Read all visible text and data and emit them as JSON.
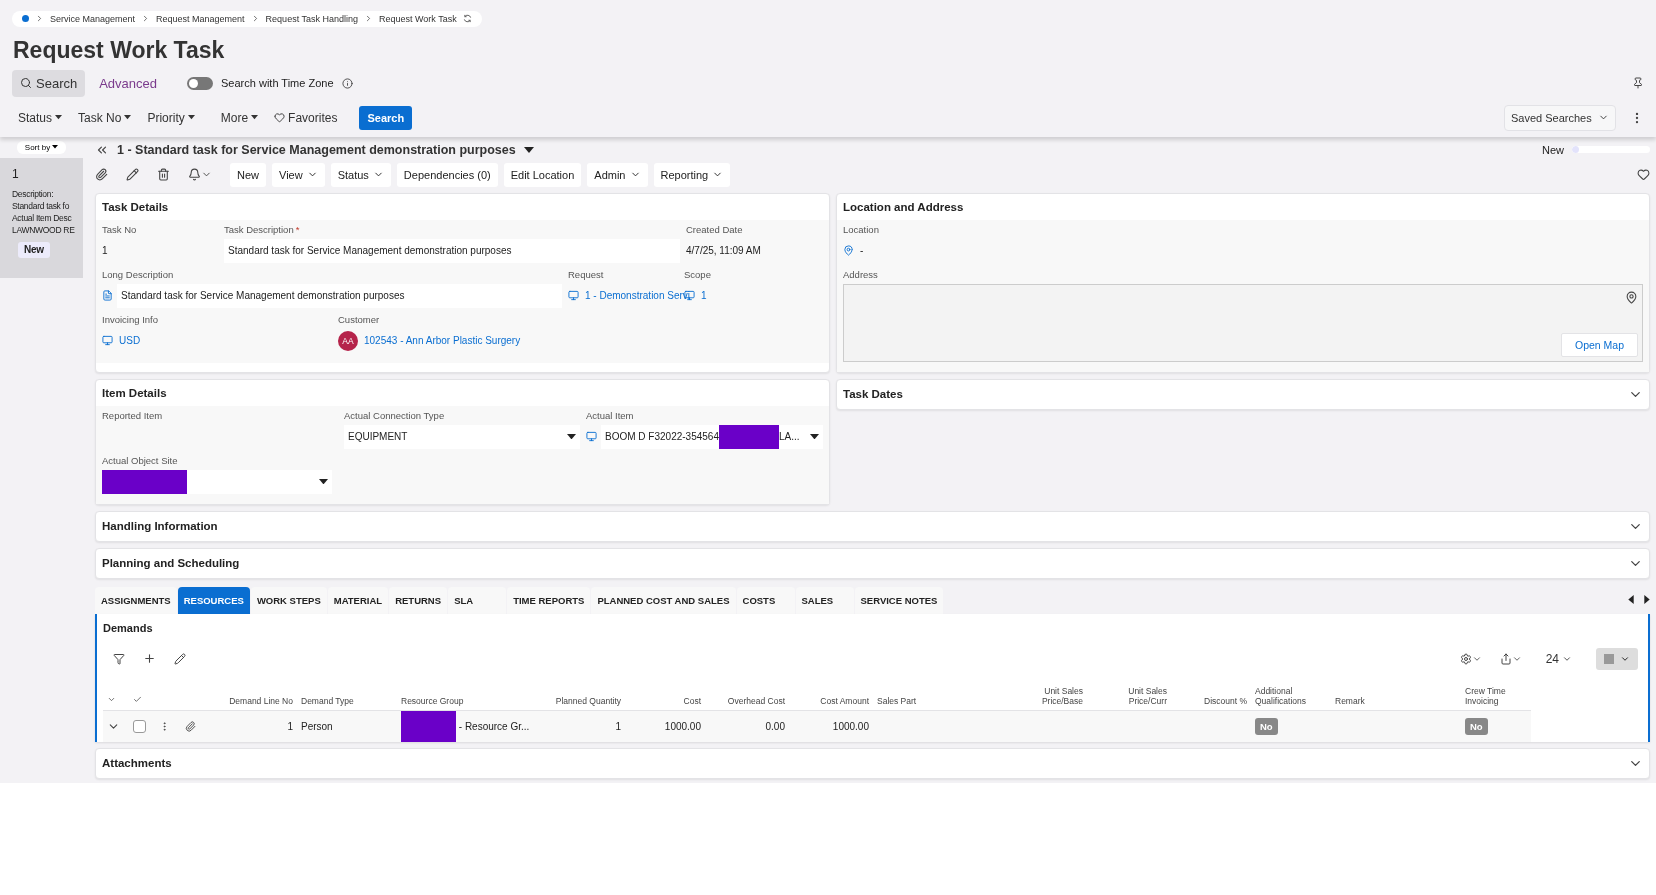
{
  "breadcrumb": [
    "Service Management",
    "Request Management",
    "Request Task Handling",
    "Request Work Task"
  ],
  "title": "Request Work Task",
  "search_bar": {
    "search_tab": "Search",
    "advanced_tab": "Advanced",
    "toggle": {
      "label": "Search with Time Zone",
      "on": false
    },
    "filters": [
      "Status",
      "Task No",
      "Priority",
      "More"
    ],
    "favorites": "Favorites",
    "search_button": "Search",
    "saved_searches": "Saved Searches"
  },
  "list_panel": {
    "sort_by": "Sort by",
    "card": {
      "number": "1",
      "lines": [
        "Description:",
        "Standard task fo",
        "Actual Item Desc",
        "LAWNWOOD RE"
      ],
      "badge": "New"
    }
  },
  "record": {
    "title": "1 - Standard task for Service Management demonstration purposes",
    "status": "New",
    "progress": {
      "level": 0.04
    },
    "toolbar": [
      {
        "label": "New",
        "menu": false
      },
      {
        "label": "View",
        "menu": true
      },
      {
        "label": "Status",
        "menu": true
      },
      {
        "label": "Dependencies (0)",
        "menu": false
      },
      {
        "label": "Edit Location",
        "menu": false
      },
      {
        "label": "Admin",
        "menu": true
      },
      {
        "label": "Reporting",
        "menu": true
      }
    ]
  },
  "task_details": {
    "title": "Task Details",
    "task_no_label": "Task No",
    "task_no": "1",
    "description_label": "Task Description",
    "description_required": "*",
    "description": "Standard task for Service Management demonstration purposes",
    "created_label": "Created Date",
    "created": "4/7/25, 11:09 AM",
    "long_description_label": "Long Description",
    "long_description": "Standard task for Service Management demonstration purposes",
    "request_label": "Request",
    "request": "1 - Demonstration Servi",
    "scope_label": "Scope",
    "scope": "1",
    "invoicing_label": "Invoicing Info",
    "invoicing": "USD",
    "customer_label": "Customer",
    "customer_initials": "AA",
    "customer": "102543 - Ann Arbor Plastic Surgery"
  },
  "location": {
    "title": "Location and Address",
    "location_label": "Location",
    "location": "-",
    "address_label": "Address",
    "open_map": "Open Map"
  },
  "task_dates": {
    "title": "Task Dates",
    "expanded": false
  },
  "item_details": {
    "title": "Item Details",
    "reported_item_label": "Reported Item",
    "connection_type_label": "Actual Connection Type",
    "connection_type": "EQUIPMENT",
    "actual_item_label": "Actual Item",
    "actual_item_start": "BOOM D F32022-354564",
    "actual_item_end": "LA...",
    "object_site_label": "Actual Object Site"
  },
  "sections": [
    {
      "title": "Handling Information",
      "expanded": false
    },
    {
      "title": "Planning and Scheduling",
      "expanded": false
    }
  ],
  "tabs": [
    {
      "label": "ASSIGNMENTS",
      "selected": false
    },
    {
      "label": "RESOURCES",
      "selected": true
    },
    {
      "label": "WORK STEPS",
      "selected": false
    },
    {
      "label": "MATERIAL",
      "selected": false
    },
    {
      "label": "RETURNS",
      "selected": false
    },
    {
      "label": "SLA",
      "selected": false
    },
    {
      "label": "TIME REPORTS",
      "selected": false
    },
    {
      "label": "PLANNED COST AND SALES",
      "selected": false
    },
    {
      "label": "COSTS",
      "selected": false
    },
    {
      "label": "SALES",
      "selected": false
    },
    {
      "label": "SERVICE NOTES",
      "selected": false
    }
  ],
  "demands": {
    "title": "Demands",
    "page_size": "24",
    "columns": [
      "Demand Line No",
      "Demand Type",
      "Resource Group",
      "Planned Quantity",
      "Cost",
      "Overhead Cost",
      "Cost Amount",
      "Sales Part",
      "Unit Sales Price/Base",
      "Unit Sales Price/Curr",
      "Discount %",
      "Additional Qualifications",
      "Remark",
      "Crew Time Invoicing"
    ],
    "rows": [
      {
        "checked": false,
        "cells": [
          {
            "kind": "text",
            "text": "1"
          },
          {
            "kind": "text",
            "text": "Person"
          },
          {
            "kind": "redacted",
            "text": " - Resource Gr..."
          },
          {
            "kind": "text",
            "text": "1"
          },
          {
            "kind": "text",
            "text": "1000.00"
          },
          {
            "kind": "text",
            "text": "0.00"
          },
          {
            "kind": "text",
            "text": "1000.00"
          },
          {
            "kind": "empty"
          },
          {
            "kind": "empty"
          },
          {
            "kind": "empty"
          },
          {
            "kind": "empty"
          },
          {
            "kind": "badge",
            "text": "No"
          },
          {
            "kind": "empty"
          },
          {
            "kind": "badge",
            "text": "No"
          }
        ]
      }
    ]
  },
  "attachments": {
    "title": "Attachments",
    "expanded": false
  }
}
